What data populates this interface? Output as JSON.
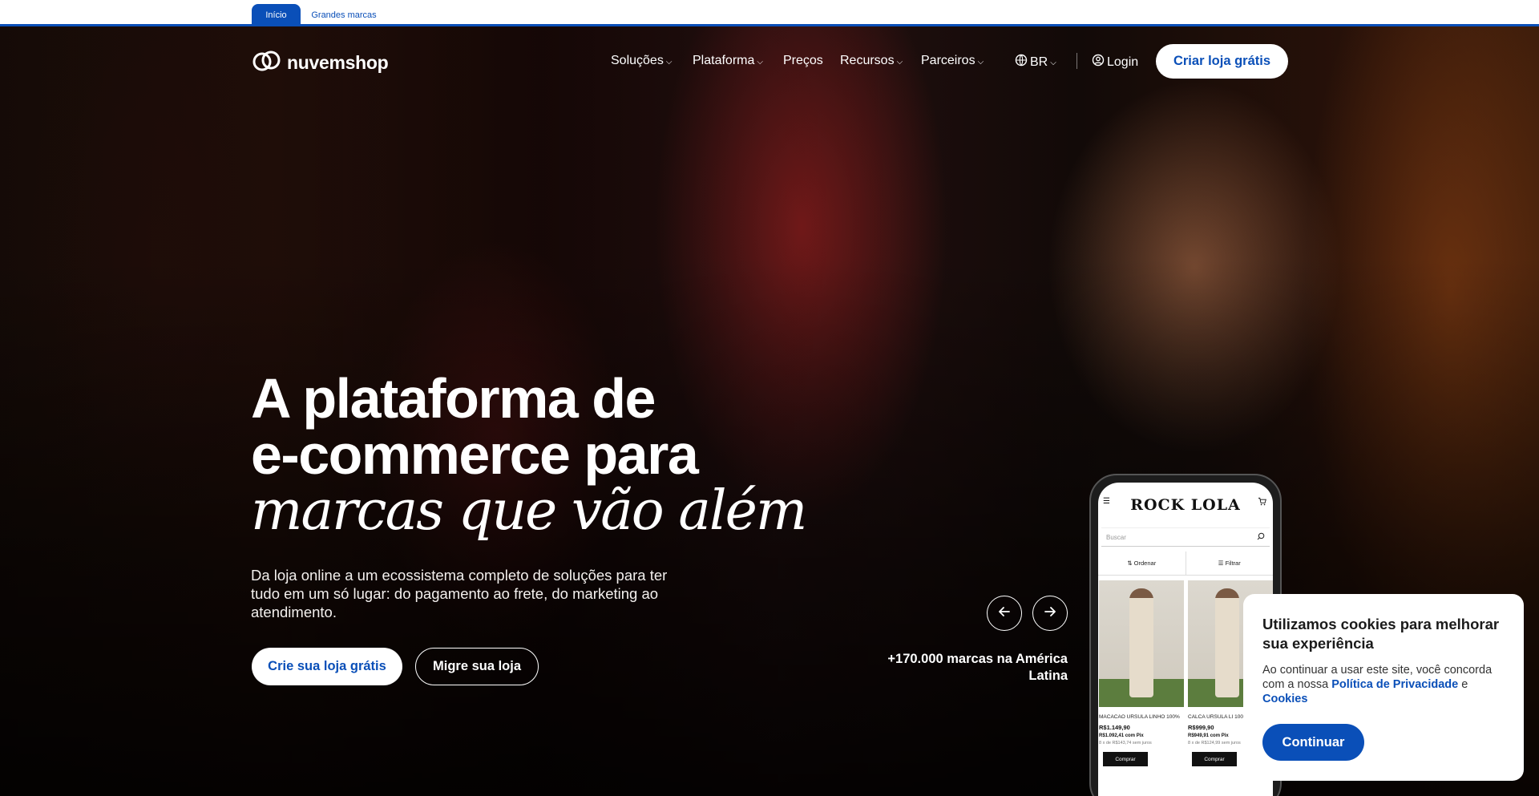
{
  "topbar": {
    "tabs": [
      {
        "label": "Início"
      },
      {
        "label": "Grandes marcas"
      }
    ]
  },
  "nav": {
    "logo_text": "nuvemshop",
    "items": [
      {
        "label": "Soluções"
      },
      {
        "label": "Plataforma"
      },
      {
        "label": "Preços"
      },
      {
        "label": "Recursos"
      },
      {
        "label": "Parceiros"
      }
    ],
    "country": "BR",
    "login": "Login",
    "cta": "Criar loja grátis"
  },
  "hero": {
    "headline_line1": "A plataforma de",
    "headline_line2": "e-commerce para",
    "headline_italic": "marcas que vão além",
    "subtitle": "Da loja online a um ecossistema completo de soluções para ter tudo em um só lugar: do pagamento ao frete, do marketing ao atendimento.",
    "primary_button": "Crie sua loja grátis",
    "secondary_button": "Migre sua loja",
    "brands_count": "+170.000 marcas na América Latina"
  },
  "phone": {
    "brand": "ROCK LOLA",
    "search_placeholder": "Buscar",
    "sort_label": "Ordenar",
    "filter_label": "Filtrar",
    "products": [
      {
        "name": "MACACAO URSULA LINHO 100%",
        "price": "R$1.149,90",
        "pix": "R$1.092,41 com Pix",
        "installments": "8 x de R$143,74 sem juros",
        "buy": "Comprar"
      },
      {
        "name": "CALCA URSULA LI 100%",
        "price": "R$999,90",
        "pix": "R$949,91 com Pix",
        "installments": "8 x de R$124,99 sem juros",
        "buy": "Comprar"
      }
    ]
  },
  "cookie": {
    "title": "Utilizamos cookies para melhorar sua experiência",
    "text_before": "Ao continuar a usar este site, você concorda com a nossa",
    "privacy_link": "Política de Privacidade",
    "connector": "e",
    "cookies_link": "Cookies",
    "button": "Continuar"
  },
  "colors": {
    "brand_blue": "#0a4fb8",
    "white": "#ffffff"
  }
}
